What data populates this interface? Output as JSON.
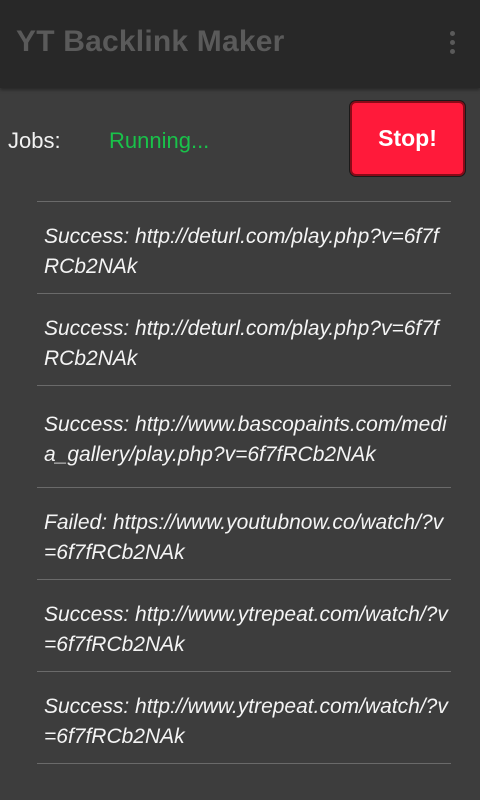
{
  "app_bar": {
    "title": "YT Backlink Maker",
    "menu_icon": "overflow-menu-icon"
  },
  "jobs": {
    "label": "Jobs:",
    "status": "Running...",
    "status_color": "#19c24a"
  },
  "stop_button": {
    "label": "Stop!",
    "color": "#ff1a3a"
  },
  "log": [
    {
      "text": "Success: http://deturl.com/play.php?v=6f7fRCb2NAk"
    },
    {
      "text": "Success: http://deturl.com/play.php?v=6f7fRCb2NAk"
    },
    {
      "text": "Success: http://www.bascopaints.com/media_gallery/play.php?v=6f7fRCb2NAk"
    },
    {
      "text": "Failed: https://www.youtubnow.co/watch/?v=6f7fRCb2NAk"
    },
    {
      "text": "Success: http://www.ytrepeat.com/watch/?v=6f7fRCb2NAk"
    },
    {
      "text": "Success: http://www.ytrepeat.com/watch/?v=6f7fRCb2NAk"
    }
  ]
}
